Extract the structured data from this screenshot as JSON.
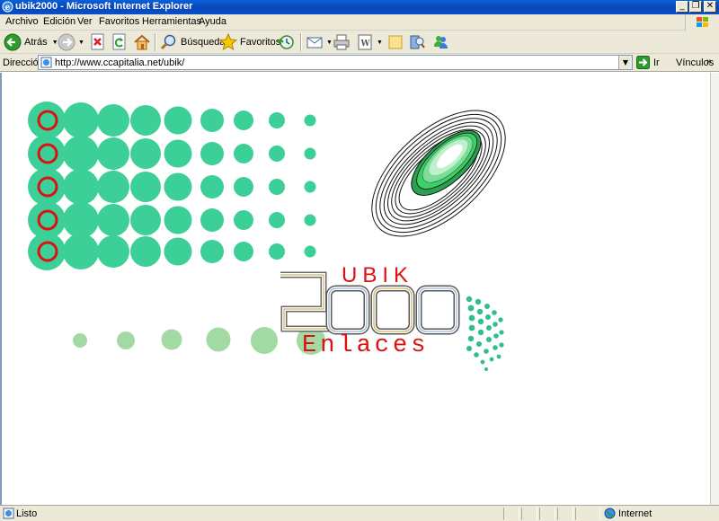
{
  "window": {
    "title": "ubik2000 - Microsoft Internet Explorer",
    "min_glyph": "_",
    "max_glyph": "❐",
    "close_glyph": "✕"
  },
  "menu": {
    "items": [
      "Archivo",
      "Edición",
      "Ver",
      "Favoritos",
      "Herramientas",
      "Ayuda"
    ]
  },
  "toolbar": {
    "back_label": "Atrás",
    "search_label": "Búsqueda",
    "favorites_label": "Favoritos"
  },
  "address": {
    "label": "Dirección",
    "url": "http://www.ccapitalia.net/ubik/",
    "go_label": "Ir",
    "links_label": "Vínculos"
  },
  "page": {
    "logo_top": "UBIK",
    "logo_number": "2000",
    "logo_bottom": "Enlaces",
    "colors": {
      "teal": "#3ccf98",
      "light_green": "#a3d9a3",
      "red": "#dd1111"
    }
  },
  "status": {
    "text": "Listo",
    "zone": "Internet"
  }
}
